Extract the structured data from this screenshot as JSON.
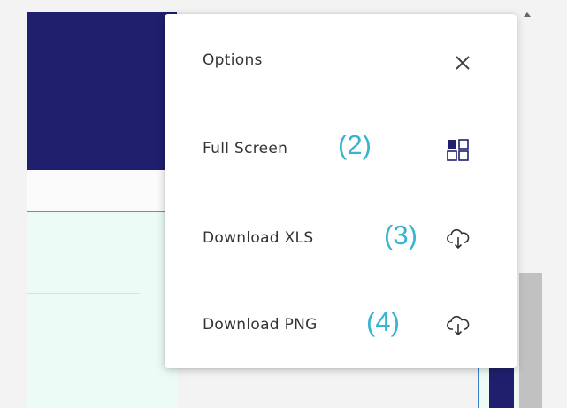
{
  "menu": {
    "title": "Options",
    "close_icon": "close-icon",
    "items": [
      {
        "label": "Full Screen",
        "marker": "(2)",
        "icon": "fullscreen-grid-icon"
      },
      {
        "label": "Download XLS",
        "marker": "(3)",
        "icon": "cloud-download-icon"
      },
      {
        "label": "Download PNG",
        "marker": "(4)",
        "icon": "cloud-download-icon"
      }
    ]
  },
  "colors": {
    "header": "#1f1f6e",
    "marker": "#36b5cf",
    "panel": "#ecfbf6",
    "accent_line": "#3aa0e0"
  }
}
